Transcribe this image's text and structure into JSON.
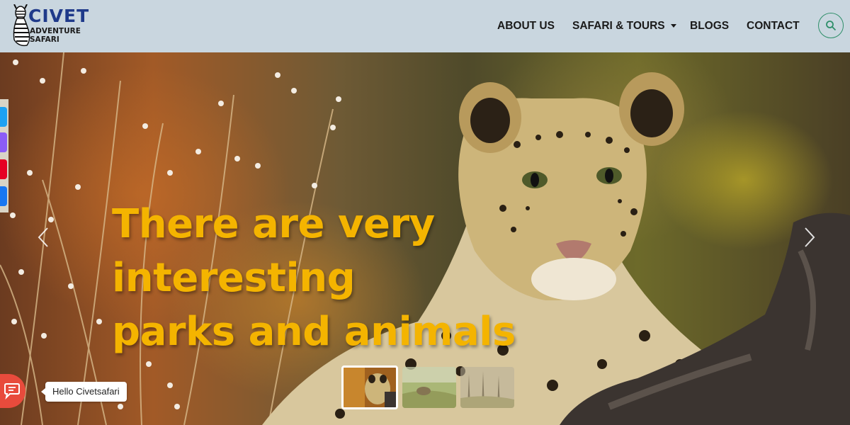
{
  "brand": {
    "name": "CIVET",
    "tagline": "ADVENTURE SAFARI",
    "logo_icon": "zebra-logo-icon",
    "title_color": "#1f3a8a"
  },
  "nav": {
    "items": [
      {
        "label": "ABOUT US",
        "has_dropdown": false
      },
      {
        "label": "SAFARI & TOURS",
        "has_dropdown": true
      },
      {
        "label": "BLOGS",
        "has_dropdown": false
      },
      {
        "label": "CONTACT",
        "has_dropdown": false
      }
    ],
    "search_icon": "search-icon",
    "background": "#c9d6df"
  },
  "hero": {
    "heading_line1": "There are very interesting",
    "heading_line2": "parks and animals",
    "heading_color": "#f4b400",
    "prev_icon": "chevron-left-icon",
    "next_icon": "chevron-right-icon",
    "slides": [
      {
        "thumb": "leopard-thumbnail",
        "active": true
      },
      {
        "thumb": "savanna-thumbnail",
        "active": false
      },
      {
        "thumb": "trees-thumbnail",
        "active": false
      }
    ]
  },
  "social": {
    "icons": [
      {
        "name": "twitter-icon",
        "color": "#1da1f2"
      },
      {
        "name": "messenger-icon",
        "color": "#8b5cf6"
      },
      {
        "name": "pinterest-icon",
        "color": "#e60023"
      },
      {
        "name": "facebook-icon",
        "color": "#1877f2"
      }
    ]
  },
  "chat": {
    "greeting": "Hello Civetsafari",
    "icon": "chat-icon",
    "color": "#e84b3c"
  }
}
